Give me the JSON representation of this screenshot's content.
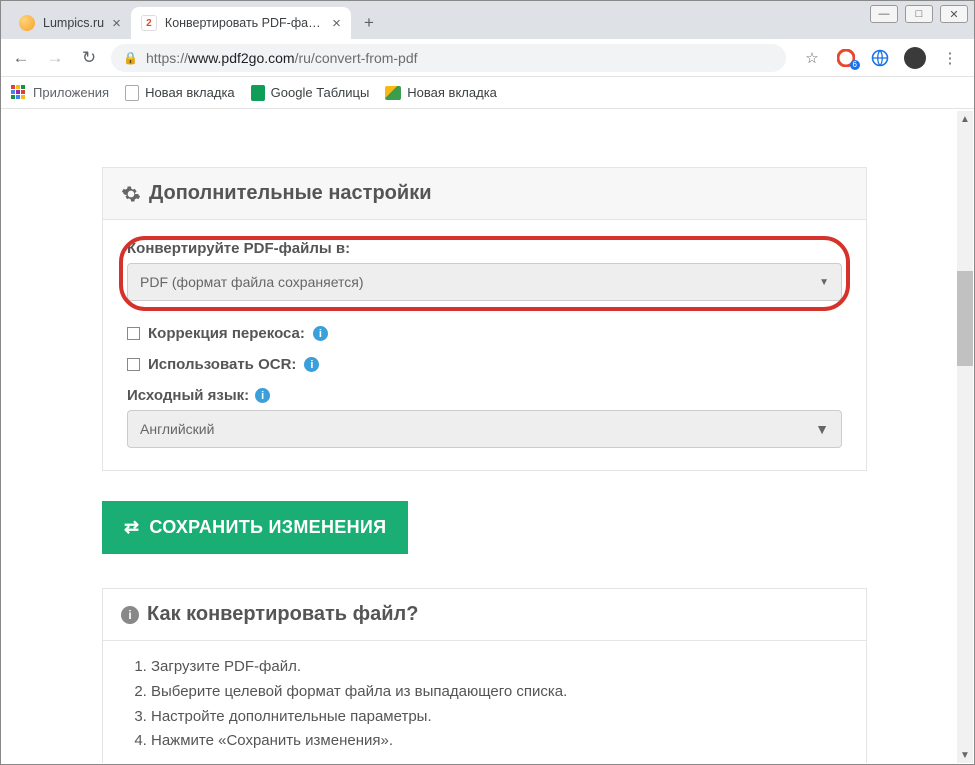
{
  "window": {
    "minimize": "—",
    "maximize": "□",
    "close": "✕"
  },
  "tabs": [
    {
      "title": "Lumpics.ru",
      "active": false
    },
    {
      "title": "Конвертировать PDF-файл — К",
      "active": true
    }
  ],
  "address": {
    "scheme": "https://",
    "host": "www.pdf2go.com",
    "path": "/ru/convert-from-pdf",
    "star": "☆",
    "badge_count": "6"
  },
  "bookmarks": {
    "apps": "Приложения",
    "newtab1": "Новая вкладка",
    "sheets": "Google Таблицы",
    "newtab2": "Новая вкладка"
  },
  "settings_card": {
    "title": "Дополнительные настройки",
    "convert_label": "Конвертируйте PDF-файлы в:",
    "convert_value": "PDF (формат файла сохраняется)",
    "deskew": "Коррекция перекоса:",
    "ocr": "Использовать OCR:",
    "lang_label": "Исходный язык:",
    "lang_value": "Английский"
  },
  "save_button": "СОХРАНИТЬ ИЗМЕНЕНИЯ",
  "howto": {
    "title": "Как конвертировать файл?",
    "steps": [
      "Загрузите PDF-файл.",
      "Выберите целевой формат файла из выпадающего списка.",
      "Настройте дополнительные параметры.",
      "Нажмите «Сохранить изменения»."
    ]
  }
}
